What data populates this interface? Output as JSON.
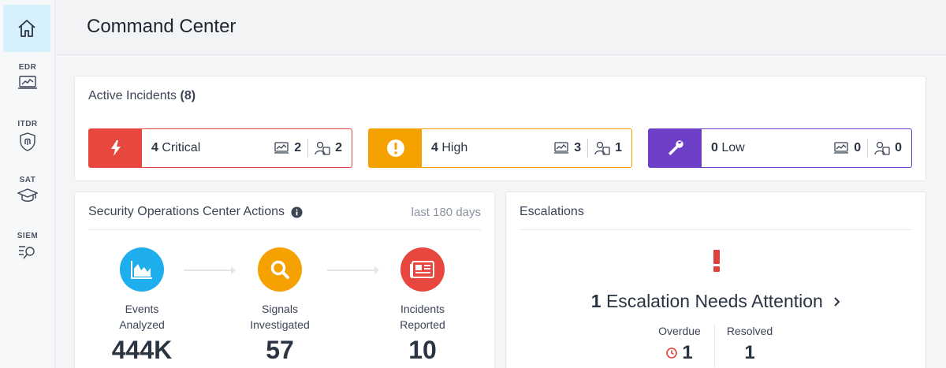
{
  "sidebar": {
    "items": [
      {
        "label": "EDR"
      },
      {
        "label": "ITDR"
      },
      {
        "label": "SAT"
      },
      {
        "label": "SIEM"
      }
    ]
  },
  "header": {
    "title": "Command Center"
  },
  "incidents": {
    "title": "Active Incidents",
    "count": "(8)",
    "severities": [
      {
        "count": "4",
        "label": "Critical",
        "endpoints": "2",
        "identities": "2",
        "color": "#e8473f"
      },
      {
        "count": "4",
        "label": "High",
        "endpoints": "3",
        "identities": "1",
        "color": "#f5a100"
      },
      {
        "count": "0",
        "label": "Low",
        "endpoints": "0",
        "identities": "0",
        "color": "#6d3fc6"
      }
    ]
  },
  "soc": {
    "title": "Security Operations Center Actions",
    "range": "last 180 days",
    "steps": [
      {
        "label_1": "Events",
        "label_2": "Analyzed",
        "value": "444K",
        "color": "#1eaeed"
      },
      {
        "label_1": "Signals",
        "label_2": "Investigated",
        "value": "57",
        "color": "#f5a100"
      },
      {
        "label_1": "Incidents",
        "label_2": "Reported",
        "value": "10",
        "color": "#e8473f"
      }
    ]
  },
  "escalations": {
    "title": "Escalations",
    "count": "1",
    "message": "Escalation Needs Attention",
    "overdue_label": "Overdue",
    "overdue_value": "1",
    "resolved_label": "Resolved",
    "resolved_value": "1"
  }
}
